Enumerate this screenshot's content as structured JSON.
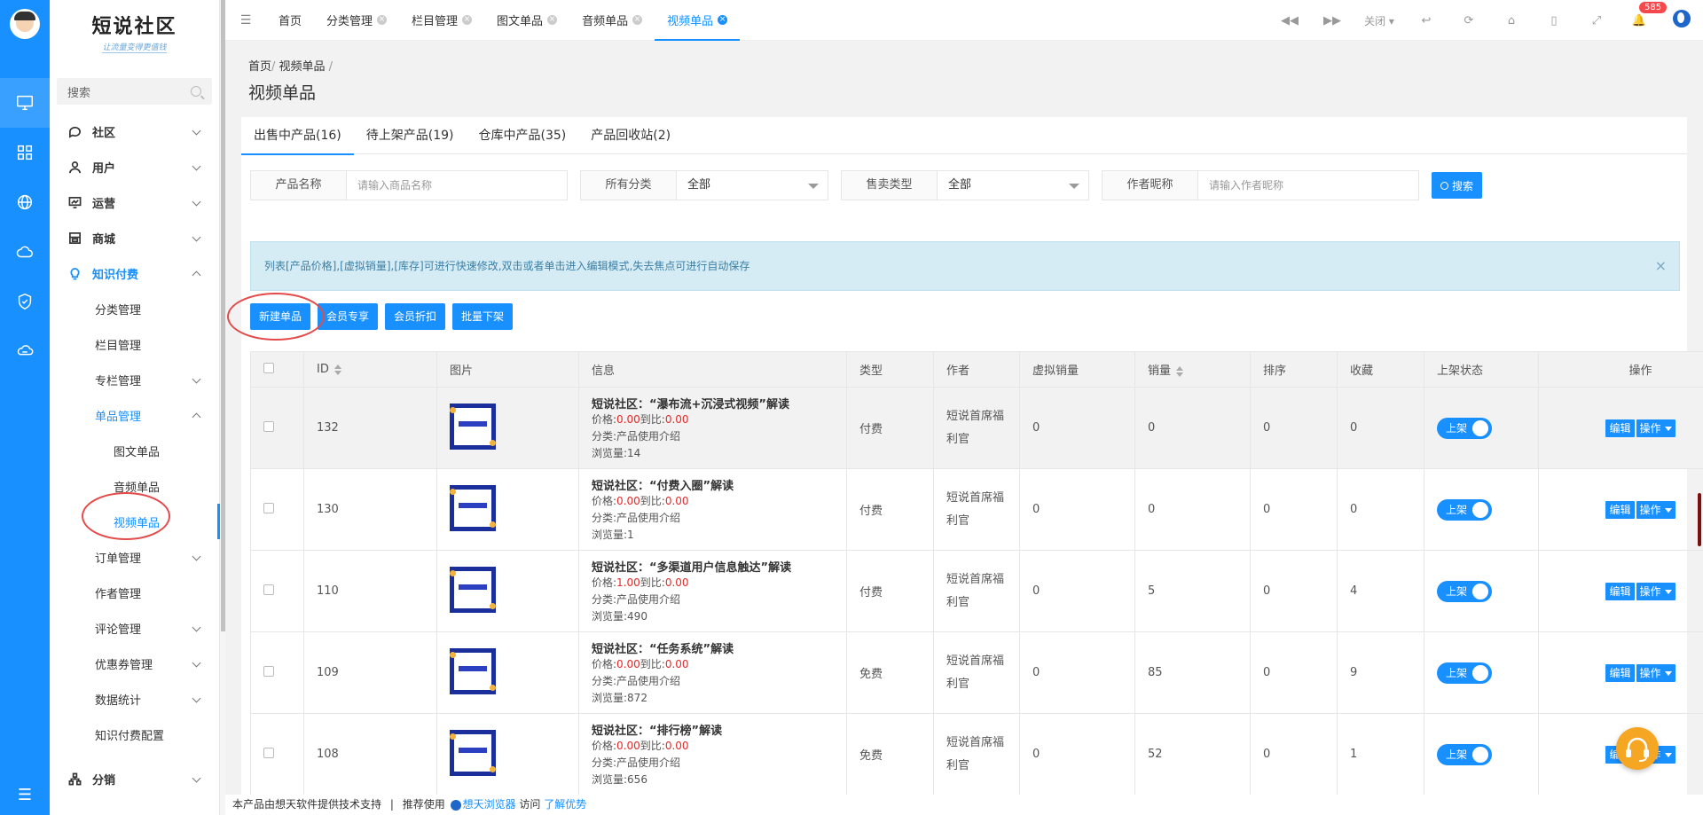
{
  "sidebar": {
    "logo_title": "短说社区",
    "logo_slogan": "让流量变得更值钱",
    "search_placeholder": "搜索",
    "menu": {
      "community": "社区",
      "users": "用户",
      "operations": "运营",
      "mall": "商城",
      "knowledge": "知识付费",
      "category_mgmt": "分类管理",
      "column_mgmt": "栏目管理",
      "special_mgmt": "专栏管理",
      "single_mgmt": "单品管理",
      "article_single": "图文单品",
      "audio_single": "音频单品",
      "video_single": "视频单品",
      "order_mgmt": "订单管理",
      "author_mgmt": "作者管理",
      "comment_mgmt": "评论管理",
      "coupon_mgmt": "优惠券管理",
      "stats": "数据统计",
      "knowledge_config": "知识付费配置",
      "distribution": "分销"
    }
  },
  "topbar": {
    "tabs": [
      "首页",
      "分类管理",
      "栏目管理",
      "图文单品",
      "音频单品",
      "视频单品"
    ],
    "close_label": "关闭",
    "notification_count": "585"
  },
  "page": {
    "breadcrumb_home": "首页",
    "breadcrumb_current": "视频单品",
    "title": "视频单品",
    "tabs": [
      "出售中产品(16)",
      "待上架产品(19)",
      "仓库中产品(35)",
      "产品回收站(2)"
    ]
  },
  "filters": {
    "name_label": "产品名称",
    "name_placeholder": "请输入商品名称",
    "category_label": "所有分类",
    "category_value": "全部",
    "sale_type_label": "售卖类型",
    "sale_type_value": "全部",
    "author_label": "作者昵称",
    "author_placeholder": "请输入作者昵称",
    "search_button": "搜索"
  },
  "notice": "列表[产品价格],[虚拟销量],[库存]可进行快速修改,双击或者单击进入编辑模式,失去焦点可进行自动保存",
  "actions": [
    "新建单品",
    "会员专享",
    "会员折扣",
    "批量下架"
  ],
  "table": {
    "columns": [
      "ID",
      "图片",
      "信息",
      "类型",
      "作者",
      "虚拟销量",
      "销量",
      "排序",
      "收藏",
      "上架状态",
      "操作"
    ],
    "price_label": "价格:",
    "discount_label": "到比:",
    "category_label": "分类:",
    "views_label": "浏览量:",
    "status_on": "上架",
    "edit_label": "编辑",
    "op_label": "操作",
    "rows": [
      {
        "id": "132",
        "title": "短说社区：“瀑布流+沉浸式视频”解读",
        "price": "0.00",
        "discount": "0.00",
        "category": "产品使用介绍",
        "views": "14",
        "type": "付费",
        "author": "短说首席福利官",
        "virtual_sales": "0",
        "sales": "0",
        "sort": "0",
        "favorites": "0"
      },
      {
        "id": "130",
        "title": "短说社区：“付费入圈”解读",
        "price": "0.00",
        "discount": "0.00",
        "category": "产品使用介绍",
        "views": "1",
        "type": "付费",
        "author": "短说首席福利官",
        "virtual_sales": "0",
        "sales": "0",
        "sort": "0",
        "favorites": "0"
      },
      {
        "id": "110",
        "title": "短说社区：“多渠道用户信息触达”解读",
        "price": "1.00",
        "discount": "0.00",
        "category": "产品使用介绍",
        "views": "490",
        "type": "付费",
        "author": "短说首席福利官",
        "virtual_sales": "0",
        "sales": "5",
        "sort": "0",
        "favorites": "4"
      },
      {
        "id": "109",
        "title": "短说社区：“任务系统”解读",
        "price": "0.00",
        "discount": "0.00",
        "category": "产品使用介绍",
        "views": "872",
        "type": "免费",
        "author": "短说首席福利官",
        "virtual_sales": "0",
        "sales": "85",
        "sort": "0",
        "favorites": "9"
      },
      {
        "id": "108",
        "title": "短说社区：“排行榜”解读",
        "price": "0.00",
        "discount": "0.00",
        "category": "产品使用介绍",
        "views": "656",
        "type": "免费",
        "author": "短说首席福利官",
        "virtual_sales": "0",
        "sales": "52",
        "sort": "0",
        "favorites": "1"
      }
    ]
  },
  "footer": {
    "text1": "本产品由想天软件提供技术支持",
    "divider": "|",
    "text2": "推荐使用",
    "browser": "想天浏览器",
    "text3": "访问",
    "link": "了解优势"
  }
}
